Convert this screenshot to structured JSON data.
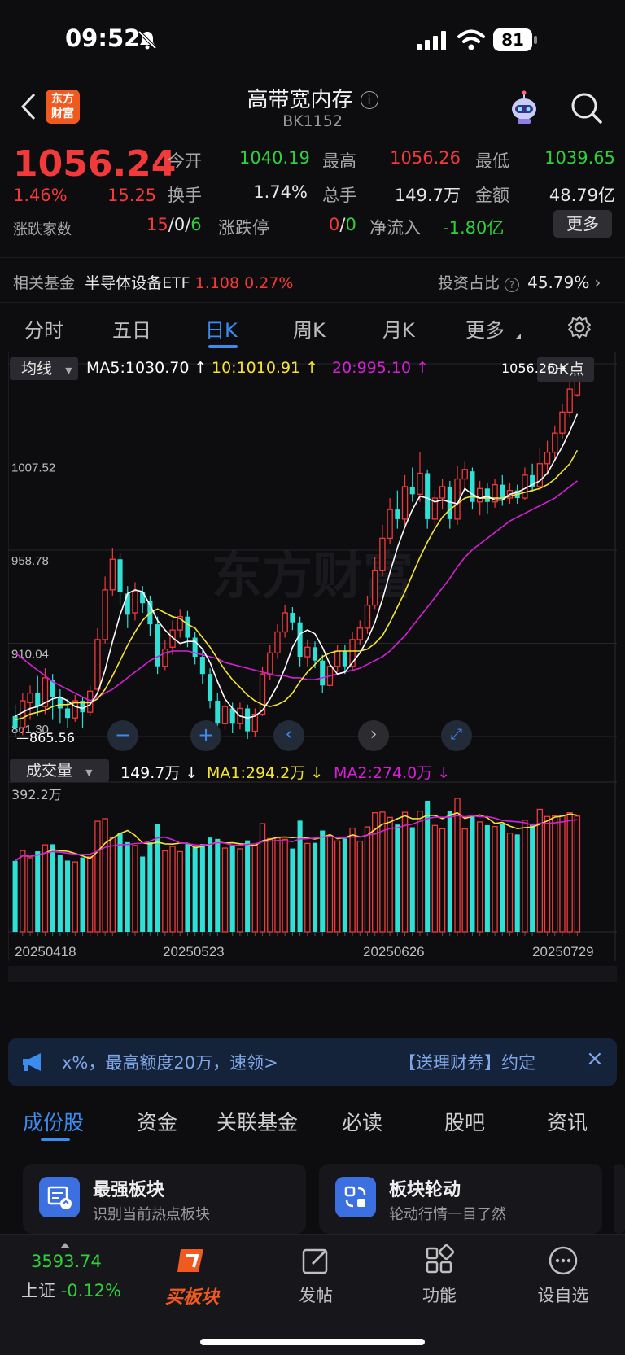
{
  "status_bar": {
    "time": "09:52",
    "battery": "81"
  },
  "header": {
    "logo_text": "东方\n财富",
    "title": "高带宽内存",
    "code": "BK1152"
  },
  "quote": {
    "price": "1056.24",
    "change_pct": "1.46%",
    "change": "15.25",
    "open_label": "今开",
    "open": "1040.19",
    "high_label": "最高",
    "high": "1056.26",
    "low_label": "最低",
    "low": "1039.65",
    "turnover_label": "换手",
    "turnover": "1.74%",
    "volume_label": "总手",
    "volume": "149.7万",
    "amount_label": "金额",
    "amount": "48.79亿",
    "breadth_label": "涨跌家数",
    "breadth_up": "15",
    "breadth_flat": "0",
    "breadth_down": "6",
    "limit_label": "涨跌停",
    "limit_up": "0",
    "limit_down": "0",
    "netflow_label": "净流入",
    "netflow": "-1.80亿",
    "more_button": "更多",
    "sep": "/"
  },
  "fund": {
    "label": "相关基金",
    "name": "半导体设备ETF",
    "price": "1.108",
    "pct": "0.27%",
    "ratio_label": "投资占比",
    "ratio": "45.79%"
  },
  "tabs": [
    "分时",
    "五日",
    "日K",
    "周K",
    "月K",
    "更多"
  ],
  "chart_controls": {
    "ma_select": "均线",
    "ma5": "MA5:1030.70",
    "ma10": "10:1010.91",
    "ma20": "20:995.10",
    "dk_button": "DK点",
    "high_tag": "1056.26",
    "low_tag": "865.56",
    "vol_select": "成交量",
    "vol_value": "149.7万",
    "vol_ma1": "MA1:294.2万",
    "vol_ma2": "MA2:274.0万",
    "vol_top": "392.2万"
  },
  "colors": {
    "up": "#f23a3a",
    "down": "#2fe0d6",
    "ma5": "#ffffff",
    "ma10": "#f5e431",
    "ma20": "#d61fd6",
    "accent": "#3c8cf0"
  },
  "chart_data": {
    "type": "candlestick",
    "price_axis_labels": [
      "1056.26",
      "1007.52",
      "958.78",
      "910.04",
      "861.30"
    ],
    "price_range": [
      861.3,
      1056.26
    ],
    "date_labels": [
      "20250418",
      "20250523",
      "20250626",
      "20250729"
    ],
    "candles": [
      {
        "o": 872,
        "c": 866,
        "h": 878,
        "l": 861
      },
      {
        "o": 866,
        "c": 880,
        "h": 884,
        "l": 862
      },
      {
        "o": 879,
        "c": 884,
        "h": 888,
        "l": 870
      },
      {
        "o": 884,
        "c": 877,
        "h": 893,
        "l": 872
      },
      {
        "o": 877,
        "c": 892,
        "h": 897,
        "l": 873
      },
      {
        "o": 891,
        "c": 882,
        "h": 894,
        "l": 870
      },
      {
        "o": 882,
        "c": 876,
        "h": 886,
        "l": 868
      },
      {
        "o": 876,
        "c": 871,
        "h": 881,
        "l": 866
      },
      {
        "o": 871,
        "c": 880,
        "h": 883,
        "l": 869
      },
      {
        "o": 880,
        "c": 874,
        "h": 882,
        "l": 866
      },
      {
        "o": 874,
        "c": 885,
        "h": 888,
        "l": 872
      },
      {
        "o": 886,
        "c": 912,
        "h": 918,
        "l": 884
      },
      {
        "o": 912,
        "c": 938,
        "h": 945,
        "l": 910
      },
      {
        "o": 938,
        "c": 954,
        "h": 960,
        "l": 935
      },
      {
        "o": 954,
        "c": 937,
        "h": 957,
        "l": 930
      },
      {
        "o": 936,
        "c": 925,
        "h": 940,
        "l": 918
      },
      {
        "o": 926,
        "c": 937,
        "h": 942,
        "l": 922
      },
      {
        "o": 937,
        "c": 931,
        "h": 940,
        "l": 926
      },
      {
        "o": 932,
        "c": 920,
        "h": 935,
        "l": 914
      },
      {
        "o": 920,
        "c": 898,
        "h": 924,
        "l": 894
      },
      {
        "o": 898,
        "c": 907,
        "h": 912,
        "l": 896
      },
      {
        "o": 908,
        "c": 917,
        "h": 922,
        "l": 904
      },
      {
        "o": 917,
        "c": 924,
        "h": 928,
        "l": 913
      },
      {
        "o": 924,
        "c": 913,
        "h": 927,
        "l": 908
      },
      {
        "o": 913,
        "c": 903,
        "h": 916,
        "l": 899
      },
      {
        "o": 903,
        "c": 894,
        "h": 907,
        "l": 889
      },
      {
        "o": 894,
        "c": 880,
        "h": 897,
        "l": 876
      },
      {
        "o": 880,
        "c": 868,
        "h": 884,
        "l": 864
      },
      {
        "o": 868,
        "c": 877,
        "h": 880,
        "l": 865
      },
      {
        "o": 876,
        "c": 868,
        "h": 879,
        "l": 863
      },
      {
        "o": 868,
        "c": 876,
        "h": 879,
        "l": 865
      },
      {
        "o": 876,
        "c": 864,
        "h": 878,
        "l": 860
      },
      {
        "o": 864,
        "c": 873,
        "h": 876,
        "l": 861
      },
      {
        "o": 873,
        "c": 894,
        "h": 898,
        "l": 872
      },
      {
        "o": 894,
        "c": 905,
        "h": 909,
        "l": 891
      },
      {
        "o": 905,
        "c": 916,
        "h": 920,
        "l": 902
      },
      {
        "o": 916,
        "c": 926,
        "h": 930,
        "l": 913
      },
      {
        "o": 926,
        "c": 921,
        "h": 929,
        "l": 917
      },
      {
        "o": 921,
        "c": 903,
        "h": 924,
        "l": 898
      },
      {
        "o": 903,
        "c": 908,
        "h": 912,
        "l": 898
      },
      {
        "o": 908,
        "c": 901,
        "h": 911,
        "l": 897
      },
      {
        "o": 901,
        "c": 888,
        "h": 904,
        "l": 884
      },
      {
        "o": 888,
        "c": 898,
        "h": 903,
        "l": 886
      },
      {
        "o": 898,
        "c": 906,
        "h": 909,
        "l": 895
      },
      {
        "o": 906,
        "c": 898,
        "h": 909,
        "l": 894
      },
      {
        "o": 898,
        "c": 912,
        "h": 916,
        "l": 896
      },
      {
        "o": 912,
        "c": 918,
        "h": 922,
        "l": 909
      },
      {
        "o": 918,
        "c": 930,
        "h": 935,
        "l": 915
      },
      {
        "o": 930,
        "c": 948,
        "h": 955,
        "l": 928
      },
      {
        "o": 948,
        "c": 965,
        "h": 972,
        "l": 945
      },
      {
        "o": 965,
        "c": 980,
        "h": 986,
        "l": 962
      },
      {
        "o": 980,
        "c": 975,
        "h": 990,
        "l": 970
      },
      {
        "o": 975,
        "c": 992,
        "h": 998,
        "l": 972
      },
      {
        "o": 992,
        "c": 988,
        "h": 1002,
        "l": 984
      },
      {
        "o": 988,
        "c": 999,
        "h": 1010,
        "l": 984
      },
      {
        "o": 999,
        "c": 975,
        "h": 1001,
        "l": 970
      },
      {
        "o": 975,
        "c": 986,
        "h": 990,
        "l": 972
      },
      {
        "o": 986,
        "c": 992,
        "h": 996,
        "l": 980
      },
      {
        "o": 992,
        "c": 975,
        "h": 995,
        "l": 970
      },
      {
        "o": 975,
        "c": 996,
        "h": 1003,
        "l": 972
      },
      {
        "o": 996,
        "c": 1001,
        "h": 1005,
        "l": 990
      },
      {
        "o": 1000,
        "c": 984,
        "h": 1002,
        "l": 980
      },
      {
        "o": 984,
        "c": 991,
        "h": 995,
        "l": 977
      },
      {
        "o": 991,
        "c": 984,
        "h": 994,
        "l": 978
      },
      {
        "o": 984,
        "c": 993,
        "h": 996,
        "l": 981
      },
      {
        "o": 993,
        "c": 986,
        "h": 998,
        "l": 982
      },
      {
        "o": 986,
        "c": 990,
        "h": 994,
        "l": 983
      },
      {
        "o": 990,
        "c": 986,
        "h": 993,
        "l": 983
      },
      {
        "o": 986,
        "c": 998,
        "h": 1002,
        "l": 985
      },
      {
        "o": 998,
        "c": 992,
        "h": 1004,
        "l": 989
      },
      {
        "o": 992,
        "c": 1004,
        "h": 1012,
        "l": 990
      },
      {
        "o": 1004,
        "c": 1010,
        "h": 1016,
        "l": 998
      },
      {
        "o": 1010,
        "c": 1020,
        "h": 1024,
        "l": 1006
      },
      {
        "o": 1020,
        "c": 1031,
        "h": 1035,
        "l": 1017
      },
      {
        "o": 1031,
        "c": 1043,
        "h": 1047,
        "l": 1028
      },
      {
        "o": 1040,
        "c": 1056,
        "h": 1056,
        "l": 1039
      }
    ],
    "ma5": [
      872,
      874,
      876,
      877,
      879,
      881,
      882,
      880,
      877,
      876,
      878,
      884,
      896,
      911,
      925,
      936,
      938,
      937,
      930,
      922,
      917,
      913,
      910,
      911,
      911,
      907,
      900,
      890,
      881,
      876,
      872,
      871,
      872,
      875,
      881,
      888,
      897,
      908,
      915,
      917,
      915,
      908,
      899,
      894,
      895,
      900,
      905,
      912,
      921,
      933,
      947,
      960,
      971,
      980,
      987,
      986,
      984,
      985,
      984,
      983,
      991,
      988,
      986,
      987,
      985,
      985,
      988,
      989,
      991,
      993,
      995,
      999,
      1006,
      1013,
      1021,
      1030
    ],
    "ma10": [
      870,
      871,
      873,
      874,
      875,
      877,
      878,
      878,
      879,
      879,
      879,
      881,
      886,
      893,
      901,
      909,
      916,
      922,
      926,
      928,
      926,
      924,
      923,
      920,
      918,
      913,
      908,
      902,
      896,
      891,
      887,
      883,
      880,
      878,
      877,
      878,
      880,
      884,
      890,
      895,
      899,
      903,
      905,
      906,
      906,
      906,
      906,
      907,
      910,
      914,
      921,
      929,
      937,
      946,
      955,
      963,
      970,
      976,
      980,
      983,
      986,
      987,
      986,
      986,
      986,
      986,
      987,
      988,
      989,
      990,
      991,
      993,
      996,
      1000,
      1004,
      1011
    ],
    "ma20": [
      905,
      902,
      899,
      896,
      893,
      890,
      888,
      886,
      884,
      882,
      880,
      882,
      884,
      886,
      889,
      892,
      895,
      898,
      901,
      903,
      905,
      906,
      906,
      906,
      905,
      904,
      903,
      902,
      900,
      899,
      898,
      897,
      896,
      895,
      894,
      893,
      893,
      892,
      892,
      891,
      891,
      892,
      893,
      894,
      895,
      896,
      897,
      899,
      901,
      903,
      906,
      910,
      914,
      919,
      924,
      929,
      934,
      939,
      944,
      950,
      955,
      959,
      962,
      965,
      968,
      971,
      974,
      976,
      978,
      980,
      982,
      984,
      986,
      989,
      992,
      995
    ]
  },
  "banner": {
    "text": "x%，最高额度20万，速领>",
    "text2": "【送理财券】约定",
    "close": "×"
  },
  "subtabs": [
    "成份股",
    "资金",
    "关联基金",
    "必读",
    "股吧",
    "资讯"
  ],
  "cards": [
    {
      "title": "最强板块",
      "subtitle": "识别当前热点板块"
    },
    {
      "title": "板块轮动",
      "subtitle": "轮动行情一目了然"
    }
  ],
  "bottom": {
    "index_value": "3593.74",
    "index_name": "上证",
    "index_pct": "-0.12%",
    "items": [
      "买板块",
      "发帖",
      "功能",
      "设自选"
    ]
  },
  "watermark": "东方财富"
}
